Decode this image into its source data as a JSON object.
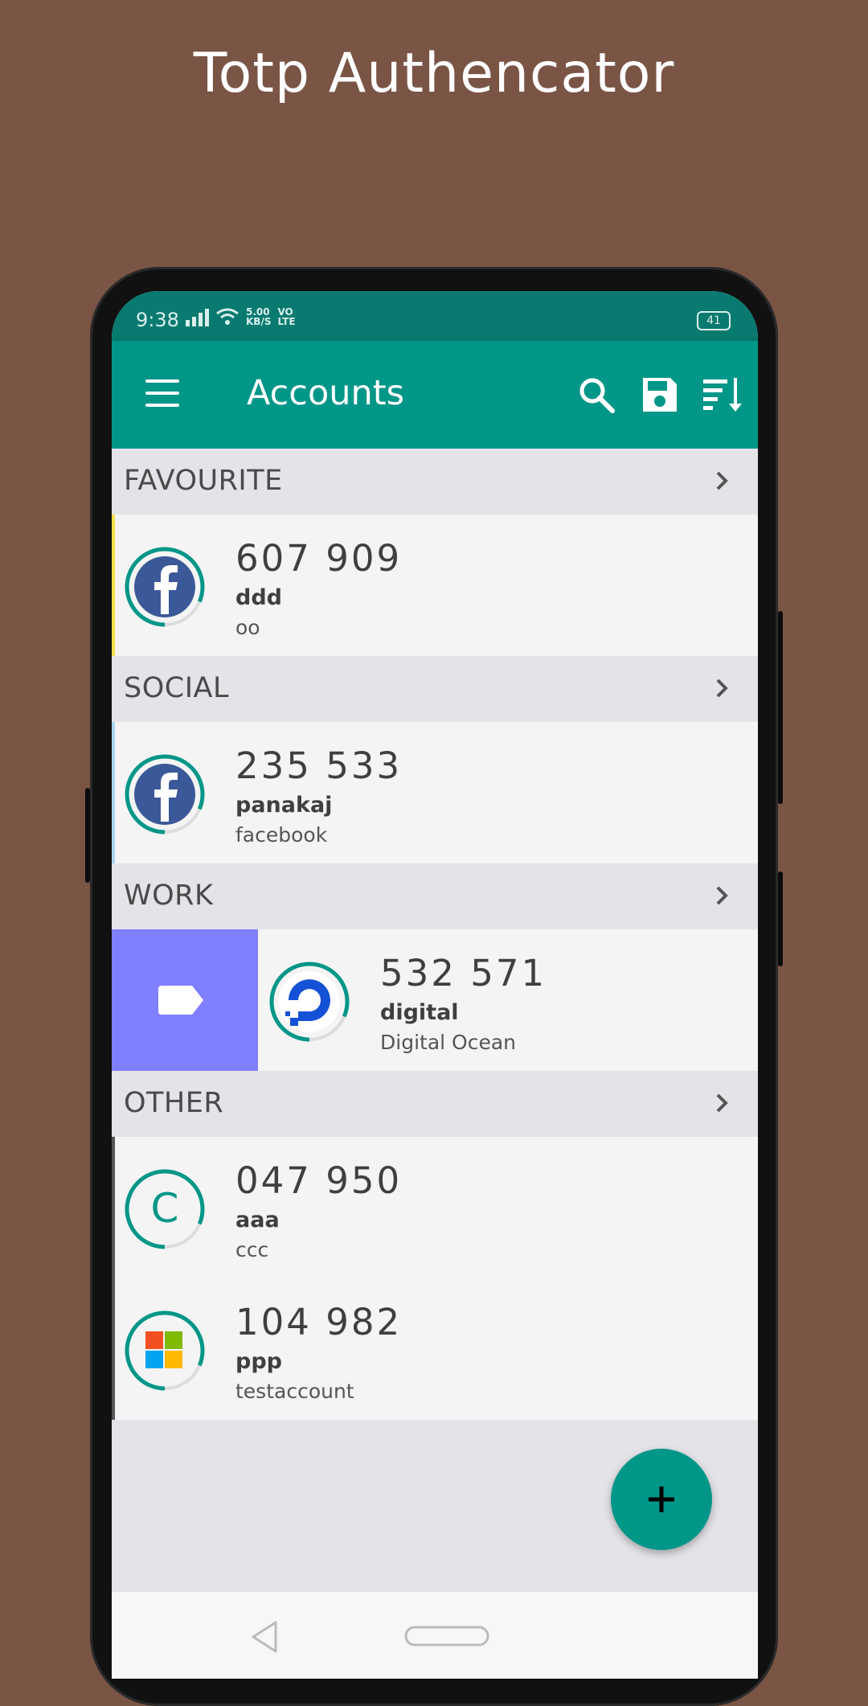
{
  "promo": {
    "title": "Totp Authencator"
  },
  "statusbar": {
    "time": "9:38",
    "speed_value": "5.00",
    "speed_unit": "KB/S",
    "volte_top": "VO",
    "volte_bottom": "LTE",
    "battery": "41"
  },
  "appbar": {
    "title": "Accounts",
    "icons": [
      "menu-icon",
      "search-icon",
      "save-icon",
      "sort-icon"
    ]
  },
  "sections": [
    {
      "label": "FAVOURITE",
      "accent": "#f2e14c",
      "accounts": [
        {
          "code": "607 909",
          "name": "ddd",
          "issuer": "oo",
          "icon": "facebook-icon"
        }
      ]
    },
    {
      "label": "SOCIAL",
      "accent": "#a8d4f5",
      "accounts": [
        {
          "code": "235 533",
          "name": "panakaj",
          "issuer": "facebook",
          "icon": "facebook-icon"
        }
      ]
    },
    {
      "label": "WORK",
      "accent": "#7f7fff",
      "accounts": [
        {
          "code": "532 571",
          "name": "digital",
          "issuer": "Digital Ocean",
          "icon": "digitalocean-icon",
          "swiped": true,
          "swipe_action": "label-tag-icon"
        }
      ]
    },
    {
      "label": "OTHER",
      "accent": "#555555",
      "accounts": [
        {
          "code": "047 950",
          "name": "aaa",
          "issuer": "ccc",
          "icon": "letter-avatar-icon",
          "avatar_letter": "C"
        },
        {
          "code": "104 982",
          "name": "ppp",
          "issuer": "testaccount",
          "icon": "microsoft-icon"
        }
      ]
    }
  ],
  "fab": {
    "icon": "add-icon"
  },
  "colors": {
    "primary": "#009688",
    "primary_dark": "#087a70",
    "background": "#7a5546",
    "swipe": "#7f7fff"
  }
}
